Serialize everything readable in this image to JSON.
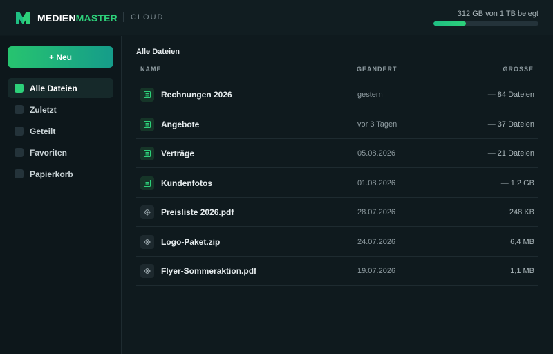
{
  "header": {
    "brand_part1": "MEDIEN",
    "brand_part2": "MASTER",
    "brand_sub": "CLOUD",
    "storage_text": "312 GB von 1 TB belegt",
    "storage_used_fraction": 0.312,
    "accent_color": "#2dd17a"
  },
  "sidebar": {
    "new_button_label": "+ Neu",
    "items": [
      {
        "label": "Alle Dateien",
        "active": true
      },
      {
        "label": "Zuletzt",
        "active": false
      },
      {
        "label": "Geteilt",
        "active": false
      },
      {
        "label": "Favoriten",
        "active": false
      },
      {
        "label": "Papierkorb",
        "active": false
      }
    ]
  },
  "main": {
    "title": "Alle Dateien",
    "columns": {
      "name": "NAME",
      "changed": "GEÄNDERT",
      "size": "GRÖSSE"
    },
    "rows": [
      {
        "icon": "folder-icon",
        "name": "Rechnungen 2026",
        "changed": "gestern",
        "size": "— 84 Dateien"
      },
      {
        "icon": "folder-icon",
        "name": "Angebote",
        "changed": "vor 3 Tagen",
        "size": "— 37 Dateien"
      },
      {
        "icon": "folder-icon",
        "name": "Verträge",
        "changed": "05.08.2026",
        "size": "— 21 Dateien"
      },
      {
        "icon": "folder-icon",
        "name": "Kundenfotos",
        "changed": "01.08.2026",
        "size": "— 1,2 GB"
      },
      {
        "icon": "file-icon",
        "name": "Preisliste 2026.pdf",
        "changed": "28.07.2026",
        "size": "248 KB"
      },
      {
        "icon": "file-icon",
        "name": "Logo-Paket.zip",
        "changed": "24.07.2026",
        "size": "6,4 MB"
      },
      {
        "icon": "file-icon",
        "name": "Flyer-Sommeraktion.pdf",
        "changed": "19.07.2026",
        "size": "1,1 MB"
      }
    ]
  }
}
